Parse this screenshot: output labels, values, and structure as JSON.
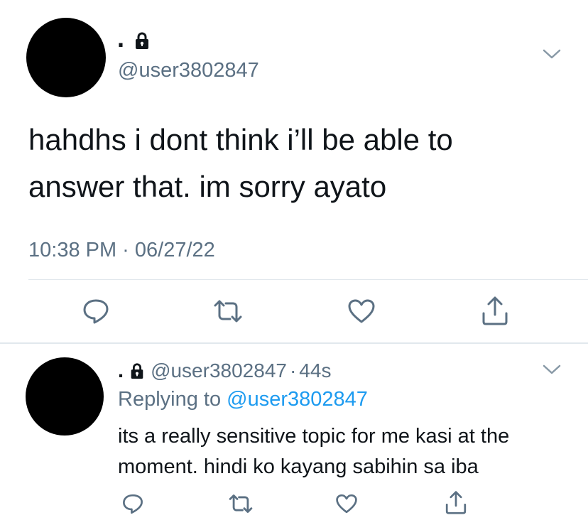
{
  "main_tweet": {
    "display_name": ".",
    "handle": "@user3802847",
    "body_line1": "hahdhs i dont think i’ll be able to",
    "body_line2": "answer that. im sorry ayato",
    "timestamp": "10:38 PM · 06/27/22",
    "icons": [
      "lock-icon",
      "chevron-down-icon",
      "reply-icon",
      "retweet-icon",
      "like-icon",
      "share-icon"
    ]
  },
  "reply_tweet": {
    "display_name": ".",
    "handle": "@user3802847",
    "time_sep": "·",
    "time_ago": "44s",
    "replying_prefix": "Replying to",
    "replying_handle": "@user3802847",
    "body_line1": "its a really sensitive topic for me kasi at the",
    "body_line2": "moment. hindi ko kayang sabihin sa iba"
  },
  "colors": {
    "text": "#0f1419",
    "muted": "#5b7083",
    "link": "#1d9bf0",
    "separator": "#e1e8ed",
    "avatar": "#000000"
  }
}
